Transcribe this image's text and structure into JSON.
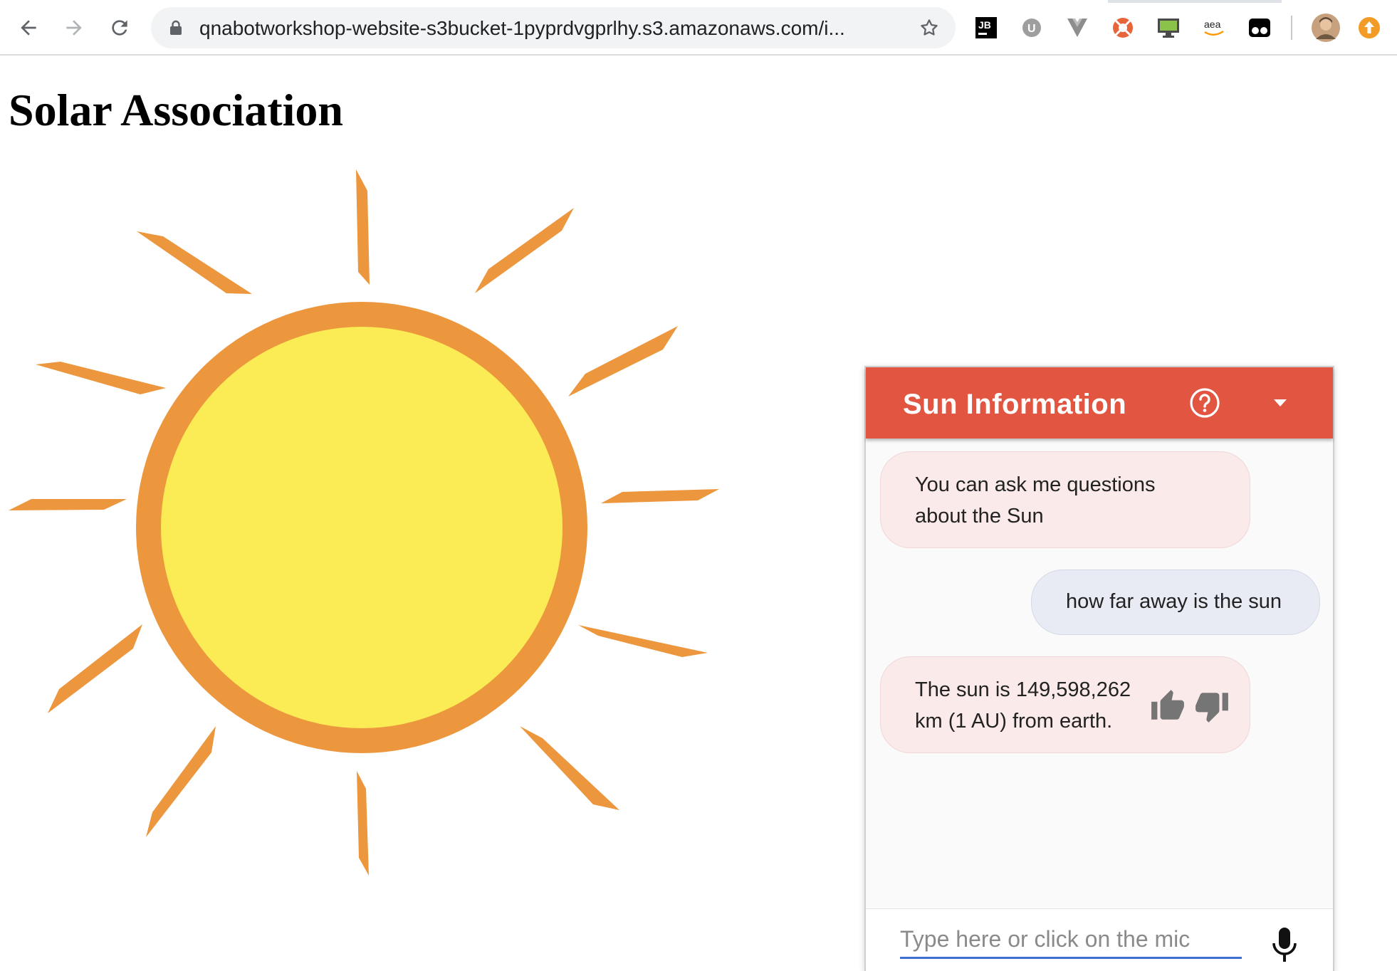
{
  "browser": {
    "url": "qnabotworkshop-website-s3bucket-1pyprdvgprlhy.s3.amazonaws.com/i...",
    "icons": [
      "back-icon",
      "forward-icon",
      "reload-icon",
      "lock-icon",
      "star-icon"
    ],
    "extensions": [
      {
        "name": "jetbrains-extension-icon",
        "label": "JB"
      },
      {
        "name": "ublock-extension-icon",
        "label": "U"
      },
      {
        "name": "vue-devtools-extension-icon",
        "label": ""
      },
      {
        "name": "lifebuoy-extension-icon",
        "label": ""
      },
      {
        "name": "monitor-extension-icon",
        "label": ""
      },
      {
        "name": "amazon-extension-icon",
        "label": "aea"
      },
      {
        "name": "tampermonkey-extension-icon",
        "label": ""
      },
      {
        "name": "profile-avatar",
        "label": ""
      },
      {
        "name": "update-icon",
        "label": ""
      }
    ]
  },
  "page": {
    "title": "Solar Association"
  },
  "chat": {
    "title": "Sun Information",
    "messages": [
      {
        "from": "bot",
        "lines": [
          "You can ask me questions",
          "about the Sun"
        ]
      },
      {
        "from": "user",
        "lines": [
          "how far away is the sun"
        ]
      },
      {
        "from": "bot",
        "lines": [
          "The sun is 149,598,262",
          "km (1 AU) from earth."
        ],
        "feedback": true
      }
    ],
    "input_placeholder": "Type here or click on the mic"
  },
  "colors": {
    "header": "#e15541",
    "sun_fill": "#fbeb55",
    "sun_ring": "#ec963e",
    "rays": "#ec963e",
    "input_underline": "#3f6fcf"
  }
}
